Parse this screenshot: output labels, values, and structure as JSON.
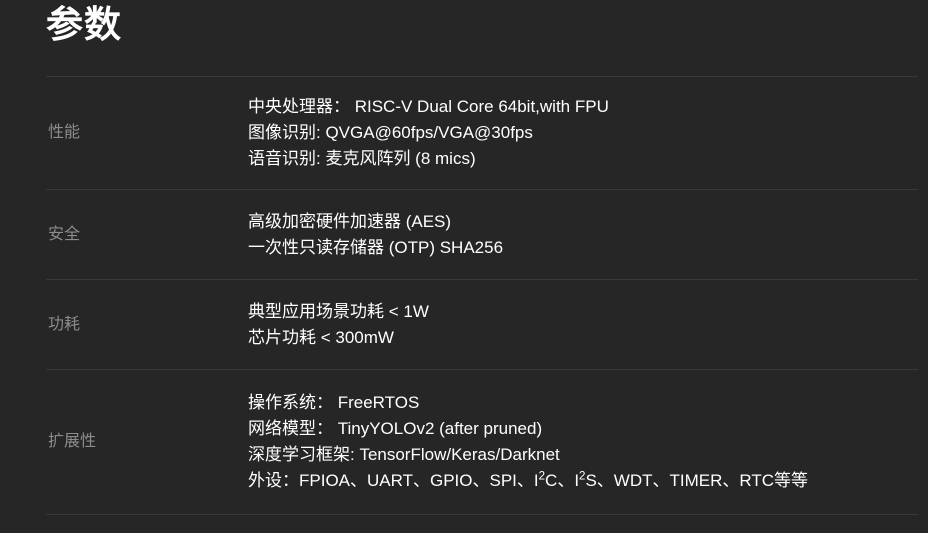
{
  "page": {
    "title": "参数",
    "background_color": "#262626",
    "text_color": "#ffffff",
    "label_color": "#8c8c8c",
    "divider_color": "#3a3a3a"
  },
  "spec_rows": [
    {
      "label": "性能",
      "lines": [
        "中央处理器：  RISC-V Dual Core 64bit,with FPU",
        "图像识别: QVGA@60fps/VGA@30fps",
        "语音识别: 麦克风阵列 (8 mics)"
      ]
    },
    {
      "label": "安全",
      "lines": [
        "高级加密硬件加速器 (AES)",
        "一次性只读存储器 (OTP) SHA256"
      ]
    },
    {
      "label": "功耗",
      "lines": [
        "典型应用场景功耗 < 1W",
        "芯片功耗 < 300mW"
      ]
    },
    {
      "label": "扩展性",
      "lines": [
        "操作系统：  FreeRTOS",
        "网络模型：  TinyYOLOv2 (after pruned)",
        "深度学习框架: TensorFlow/Keras/Darknet"
      ],
      "peripherals": {
        "prefix": "外设：FPIOA、UART、GPIO、SPI、I",
        "sup1": "2",
        "mid": "C、I",
        "sup2": "2",
        "suffix": "S、WDT、TIMER、RTC等等"
      }
    }
  ]
}
